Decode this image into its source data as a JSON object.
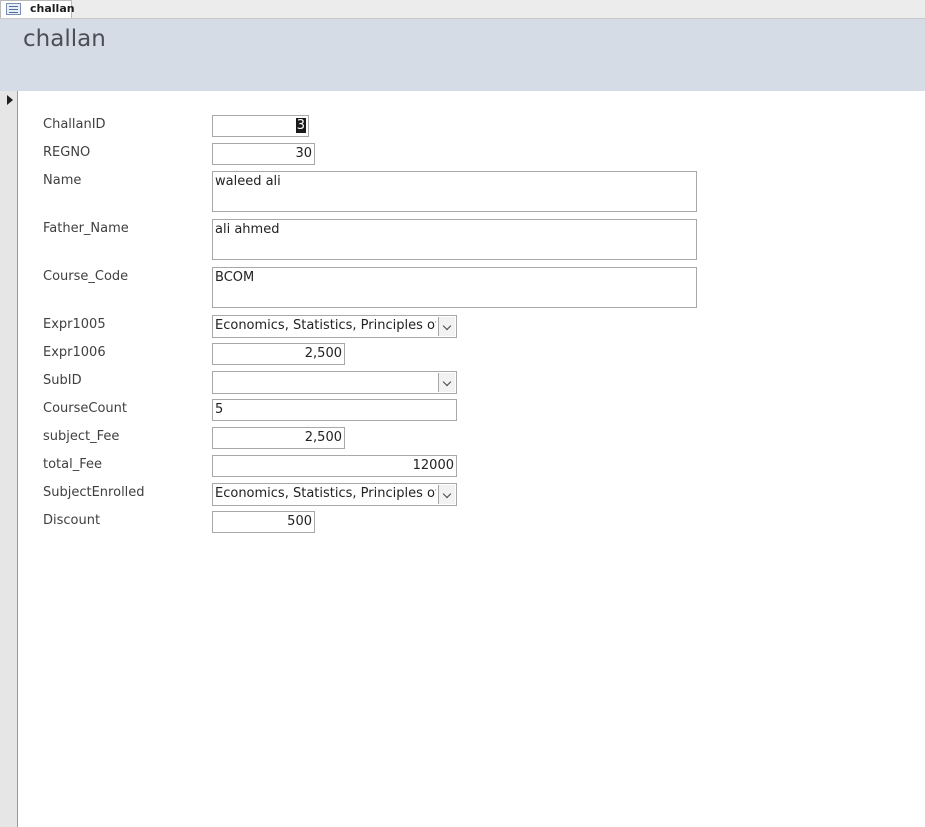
{
  "tab": {
    "label": "challan",
    "icon": "form-icon"
  },
  "form": {
    "title": "challan"
  },
  "record_selector": {
    "icon": "current-record-arrow-icon"
  },
  "fields": {
    "challan_id": {
      "label": "ChallanID",
      "value": "3"
    },
    "regno": {
      "label": "REGNO",
      "value": "30"
    },
    "name": {
      "label": "Name",
      "value": "waleed ali"
    },
    "father_name": {
      "label": "Father_Name",
      "value": "ali ahmed"
    },
    "course_code": {
      "label": "Course_Code",
      "value": "BCOM"
    },
    "expr1005": {
      "label": "Expr1005",
      "value": "Economics, Statistics, Principles of A"
    },
    "expr1006": {
      "label": "Expr1006",
      "value": "2,500"
    },
    "sub_id": {
      "label": "SubID",
      "value": ""
    },
    "course_count": {
      "label": "CourseCount",
      "value": "5"
    },
    "subject_fee": {
      "label": "subject_Fee",
      "value": "2,500"
    },
    "total_fee": {
      "label": "total_Fee",
      "value": "12000"
    },
    "subject_enrolled": {
      "label": "SubjectEnrolled",
      "value": "Economics, Statistics, Principles of A"
    },
    "discount": {
      "label": "Discount",
      "value": "500"
    }
  },
  "colors": {
    "header_bg": "#d6dce5",
    "selector_bg": "#e6e6e6"
  }
}
